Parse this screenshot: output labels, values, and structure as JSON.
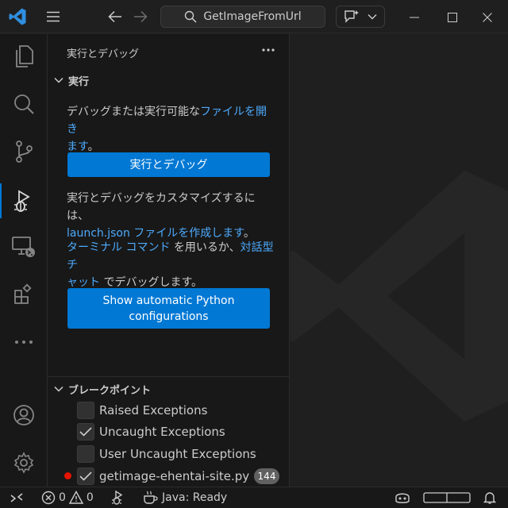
{
  "titlebar": {
    "search_text": "GetImageFromUrl"
  },
  "sidebar": {
    "title": "実行とデバッグ",
    "run_section": {
      "header": "実行",
      "intro_text": "デバッグまたは実行可能な",
      "open_file_link": "ファイルを開き",
      "open_file_link_cont": "ます",
      "intro_end": "。",
      "run_debug_button": "実行とデバッグ",
      "customize_text": "実行とデバッグをカスタマイズするには、",
      "launch_json_link": "launch.json ファイルを作成します",
      "customize_end": "。",
      "terminal_link": "ターミナル コマンド",
      "terminal_mid": " を用いるか、",
      "chat_link": "対話型チ",
      "chat_link_cont": "ャット",
      "terminal_end": " でデバッグします。",
      "python_button_line1": "Show automatic Python",
      "python_button_line2": "configurations"
    },
    "breakpoints": {
      "header": "ブレークポイント",
      "items": [
        {
          "label": "Raised Exceptions",
          "checked": false
        },
        {
          "label": "Uncaught Exceptions",
          "checked": true
        },
        {
          "label": "User Uncaught Exceptions",
          "checked": false
        },
        {
          "label": "getimage-ehentai-site.py",
          "checked": true,
          "count": "144"
        }
      ]
    }
  },
  "statusbar": {
    "errors": "0",
    "warnings": "0",
    "java_status": "Java: Ready"
  },
  "colors": {
    "accent": "#0078d4",
    "link": "#4daafc",
    "breakpoint": "#e51400"
  }
}
